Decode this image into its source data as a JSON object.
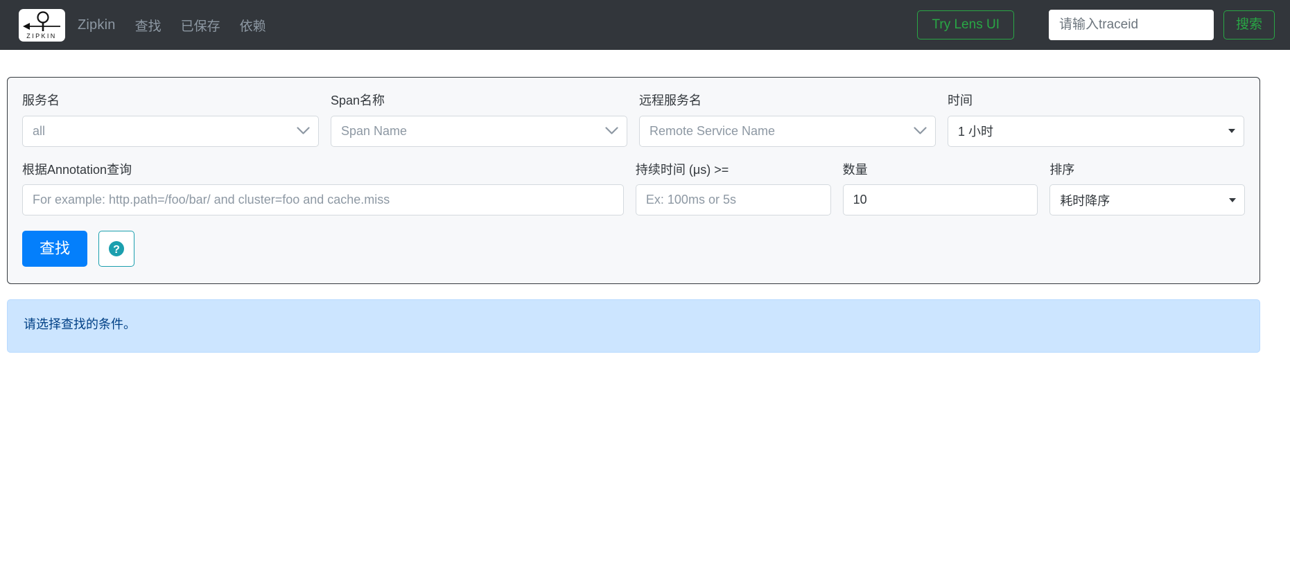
{
  "header": {
    "logo_text": "ZIPKIN",
    "brand": "Zipkin",
    "nav_items": [
      {
        "label": "查找",
        "name": "find"
      },
      {
        "label": "已保存",
        "name": "saved"
      },
      {
        "label": "依赖",
        "name": "dependencies"
      }
    ],
    "lens_button": "Try Lens UI",
    "trace_placeholder": "请输入traceid",
    "trace_value": "",
    "search_button": "搜索",
    "colors": {
      "bar_background": "#32363b",
      "nav_text": "#8d98a3",
      "accent_green": "#29a745"
    }
  },
  "search_form": {
    "row1": [
      {
        "name": "service-name",
        "label": "服务名",
        "value": "all",
        "value_is_placeholder": true,
        "control": "select-chevron"
      },
      {
        "name": "span-name",
        "label": "Span名称",
        "value": "Span Name",
        "value_is_placeholder": true,
        "control": "select-chevron"
      },
      {
        "name": "remote-service-name",
        "label": "远程服务名",
        "value": "Remote Service Name",
        "value_is_placeholder": true,
        "control": "select-chevron"
      },
      {
        "name": "lookback",
        "label": "时间",
        "value": "1 小时",
        "value_is_placeholder": false,
        "control": "select-native"
      }
    ],
    "row2": {
      "annotation": {
        "label": "根据Annotation查询",
        "placeholder": "For example: http.path=/foo/bar/ and cluster=foo and cache.miss",
        "value": ""
      },
      "duration": {
        "label": "持续时间 (μs) >=",
        "placeholder": "Ex: 100ms or 5s",
        "value": ""
      },
      "limit": {
        "label": "数量",
        "placeholder": "",
        "value": "10"
      },
      "sort": {
        "label": "排序",
        "value": "耗时降序",
        "control": "select-native"
      }
    },
    "actions": {
      "find_label": "查找",
      "find_color": "#047ffb",
      "help_icon": "question-circle-icon",
      "help_color": "#1b9fae"
    }
  },
  "banner": {
    "message": "请选择查找的条件。",
    "background": "#cce5ff",
    "text_color": "#004085"
  }
}
